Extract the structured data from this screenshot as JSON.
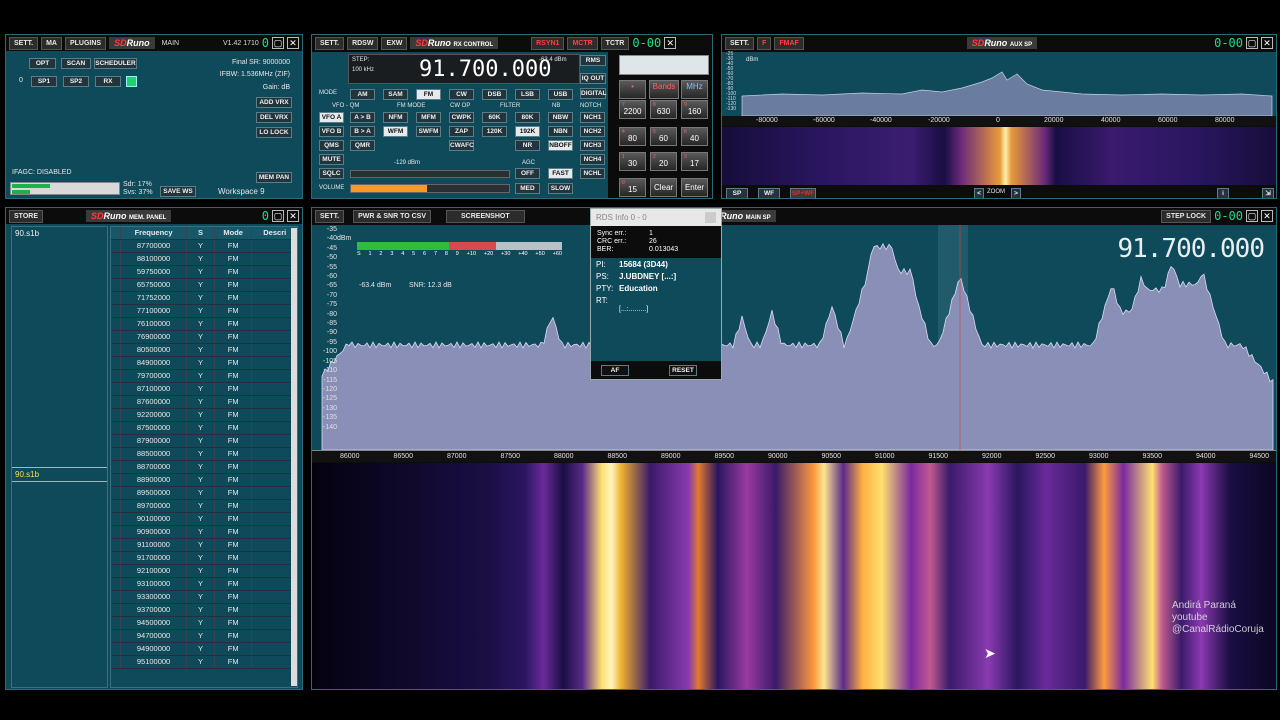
{
  "main": {
    "sett": "SETT.",
    "ma": "MA",
    "plugins": "PLUGINS",
    "logo_sd": "SD",
    "logo_runo": "Runo",
    "name": "MAIN",
    "version": "V1.42 1710",
    "opt": "OPT",
    "scan": "SCAN",
    "scheduler": "SCHEDULER",
    "sp1": "SP1",
    "sp2": "SP2",
    "rx": "RX",
    "vrx_index": "0",
    "final_sr": "Final SR: 9000000",
    "ifbw": "IFBW: 1.536MHz (ZIF)",
    "gain": "Gain: dB",
    "add_vrx": "ADD VRX",
    "del_vrx": "DEL VRX",
    "lo_lock": "LO LOCK",
    "ifagc": "IFAGC: DISABLED",
    "sdr": "Sdr: 17%",
    "svs": "Svs: 37%",
    "save_ws": "SAVE WS",
    "workspace": "Workspace 9",
    "mem_pan": "MEM PAN"
  },
  "rx": {
    "sett": "SETT.",
    "rdsw": "RDSW",
    "exw": "EXW",
    "name": "RX CONTROL",
    "rsyn": "RSYN1",
    "mctr": "MCTR",
    "tctr": "TCTR",
    "step_label": "STEP:",
    "step_value": "100 kHz",
    "frequency": "91.700.000",
    "dbm": "-63.4 dBm",
    "rms": "RMS",
    "iq_out": "IQ OUT",
    "digital": "DIGITAL",
    "mode_label": "MODE",
    "modes": [
      "AM",
      "SAM",
      "FM",
      "CW",
      "DSB",
      "LSB",
      "USB"
    ],
    "vfo_qm": "VFO - QM",
    "fm_mode": "FM MODE",
    "cw_op": "CW OP",
    "filter": "FILTER",
    "nb": "NB",
    "notch": "NOTCH",
    "vfo_a": "VFO A",
    "a_to_b": "A > B",
    "nfm": "NFM",
    "mfm": "MFM",
    "cwpk": "CWPK",
    "f60k": "60K",
    "f80k": "80K",
    "nbw": "NBW",
    "nch1": "NCH1",
    "vfo_b": "VFO B",
    "b_to_a": "B > A",
    "wfm": "WFM",
    "swfm": "SWFM",
    "zap": "ZAP",
    "f120k": "120K",
    "f192k": "192K",
    "nbn": "NBN",
    "nch2": "NCH2",
    "qms": "QMS",
    "qmr": "QMR",
    "cwafc": "CWAFC",
    "nr": "NR",
    "nboff": "NBOFF",
    "nch3": "NCH3",
    "mute": "MUTE",
    "sqlc": "SQLC",
    "volume": "VOLUME",
    "sq_dbm": "-129 dBm",
    "agc": "AGC",
    "off": "OFF",
    "fast": "FAST",
    "med": "MED",
    "slow": "SLOW",
    "nch4": "NCH4",
    "nchl": "NCHL",
    "keypad": {
      "bands": "Bands",
      "mhz": "MHz",
      "k7": "7",
      "k7s": "2200",
      "k8": "8",
      "k8s": "630",
      "k9": "9",
      "k9s": "160",
      "k4": "4",
      "k4s": "80",
      "k5": "5",
      "k5s": "60",
      "k6": "6",
      "k6s": "40",
      "k1": "1",
      "k1s": "30",
      "k2": "2",
      "k2s": "20",
      "k3": "3",
      "k3s": "17",
      "k0": "0",
      "k0s": "15",
      "clear": "Clear",
      "enter": "Enter"
    }
  },
  "aux": {
    "sett": "SETT.",
    "f": "F",
    "fmaf": "FMAF",
    "name": "AUX SP",
    "dbm": "dBm",
    "yticks": [
      "-25",
      "-30",
      "-40",
      "-50",
      "-60",
      "-70",
      "-80",
      "-90",
      "-100",
      "-110",
      "-120",
      "-130"
    ],
    "xticks": [
      "-80000",
      "-60000",
      "-40000",
      "-20000",
      "0",
      "20000",
      "40000",
      "60000",
      "80000"
    ],
    "sp": "SP",
    "wf": "WF",
    "spwf": "SP+WF",
    "zoom": "ZOOM",
    "zoom_l": "<",
    "zoom_r": ">",
    "info": "i"
  },
  "mem": {
    "store": "STORE",
    "name": "MEM. PANEL",
    "group": "90.s1b",
    "group2": "90.s1b",
    "headers": [
      "Frequency",
      "S",
      "Mode",
      "Descri"
    ],
    "rows": [
      "87700000",
      "88100000",
      "59750000",
      "65750000",
      "71752000",
      "77100000",
      "76100000",
      "76900000",
      "80500000",
      "84900000",
      "79700000",
      "87100000",
      "87600000",
      "92200000",
      "87500000",
      "87900000",
      "88500000",
      "88700000",
      "88900000",
      "89500000",
      "89700000",
      "90100000",
      "90900000",
      "91100000",
      "91700000",
      "92100000",
      "93100000",
      "93300000",
      "93700000",
      "94500000",
      "94700000",
      "94900000",
      "95100000"
    ],
    "s_val": "Y",
    "mode_val": "FM"
  },
  "mainsp": {
    "sett": "SETT.",
    "pwr_snr": "PWR & SNR TO CSV",
    "screenshot": "SCREENSHOT",
    "name": "MAIN SP",
    "step_lock": "STEP LOCK",
    "frequency": "91.700.000",
    "dbm_label": "dBm",
    "smeter": [
      "S",
      "1",
      "2",
      "3",
      "4",
      "5",
      "6",
      "7",
      "8",
      "9",
      "+10",
      "+20",
      "+30",
      "+40",
      "+50",
      "+60"
    ],
    "level": "-63.4 dBm",
    "snr": "SNR: 12.3 dB",
    "yticks": [
      "-35",
      "-40",
      "-45",
      "-50",
      "-55",
      "-60",
      "-65",
      "-70",
      "-75",
      "-80",
      "-85",
      "-90",
      "-95",
      "-100",
      "-105",
      "-110",
      "-115",
      "-120",
      "-125",
      "-130",
      "-135",
      "-140"
    ],
    "xticks": [
      "86000",
      "86500",
      "87000",
      "87500",
      "88000",
      "88500",
      "89000",
      "89500",
      "90000",
      "90500",
      "91000",
      "91500",
      "92000",
      "92500",
      "93000",
      "93500",
      "94000",
      "94500"
    ]
  },
  "rds": {
    "title": "RDS Info 0 - 0",
    "sync_label": "Sync err.:",
    "sync_val": "1",
    "crc_label": "CRC err.:",
    "crc_val": "26",
    "ber_label": "BER:",
    "ber_val": "0.013043",
    "pi_label": "PI:",
    "pi_val": "15684 (3D44)",
    "ps_label": "PS:",
    "ps_val": "J.UBDNEY [...:]",
    "pty_label": "PTY:",
    "pty_val": "Education",
    "rt_label": "RT:",
    "rt_val": "[...:.........]",
    "af": "AF",
    "reset": "RESET"
  },
  "overlay": {
    "line1": "Andirá Paraná",
    "line2": "youtube",
    "line3": "@CanalRádioCoruja"
  },
  "colors": {
    "panel": "#0f4a5a",
    "spectrum": "#8a8fb8",
    "freq_digits": "#e8eef2",
    "accent_green": "#1ddb8a",
    "logo_red": "#ff3b3b"
  }
}
